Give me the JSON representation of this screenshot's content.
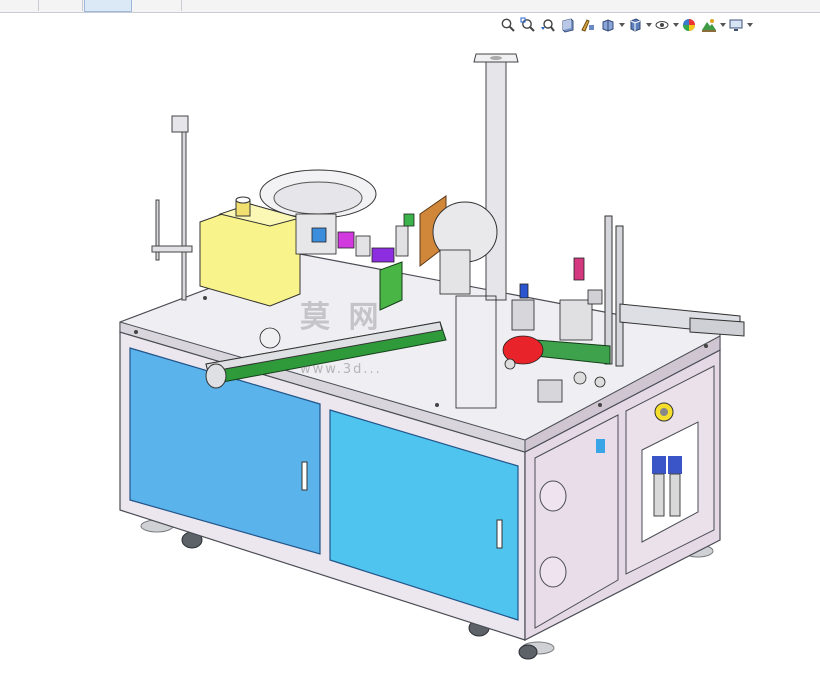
{
  "toolbar": {
    "icons": [
      {
        "name": "zoom-to-fit-icon"
      },
      {
        "name": "zoom-to-area-icon"
      },
      {
        "name": "previous-view-icon"
      },
      {
        "name": "section-view-icon"
      },
      {
        "name": "dynamic-annotation-icon"
      },
      {
        "name": "view-orientation-icon",
        "dropdown": true
      },
      {
        "name": "display-style-icon",
        "dropdown": true
      },
      {
        "name": "hide-show-items-icon",
        "dropdown": true
      },
      {
        "name": "edit-appearance-icon"
      },
      {
        "name": "apply-scene-icon",
        "dropdown": true
      },
      {
        "name": "view-settings-icon",
        "dropdown": true
      }
    ]
  },
  "watermark": {
    "text": "莫 网",
    "url": "www.3d..."
  },
  "colors": {
    "cabinet_blue": "#4fc4ef",
    "cabinet_blue_left": "#5ab3ea",
    "frame_pink": "#e9dfe9",
    "top_panel": "#ecebef",
    "feeder_yellow": "#f8f38a",
    "conveyor_green": "#2e9a3a",
    "accent_red": "#e8232a"
  }
}
